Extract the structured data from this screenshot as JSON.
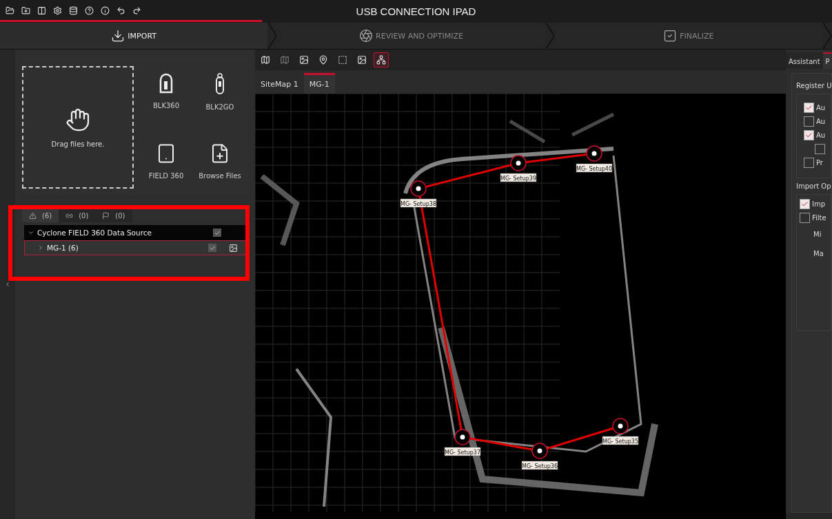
{
  "window": {
    "title": "USB CONNECTION IPAD"
  },
  "steps": [
    {
      "label": "IMPORT",
      "selected": true
    },
    {
      "label": "REVIEW AND OPTIMIZE",
      "selected": false
    },
    {
      "label": "FINALIZE",
      "selected": false
    }
  ],
  "import_panel": {
    "drop_zone": "Drag files here.",
    "sources": [
      {
        "label": "BLK360",
        "kind": "blk360"
      },
      {
        "label": "BLK2GO",
        "kind": "blk2go"
      },
      {
        "label": "FIELD 360",
        "kind": "tablet"
      },
      {
        "label": "Browse Files",
        "kind": "browse"
      }
    ]
  },
  "source_tabs": [
    {
      "count": "(6)",
      "kind": "setups",
      "selected": true
    },
    {
      "count": "(0)",
      "kind": "links",
      "selected": false
    },
    {
      "count": "(0)",
      "kind": "flags",
      "selected": false
    }
  ],
  "tree": [
    {
      "label": "Cyclone FIELD 360 Data Source",
      "expanded": true,
      "checked": true,
      "selected": false,
      "children": [
        {
          "label": "MG-1 (6)",
          "expanded": false,
          "checked": true,
          "selected": true
        }
      ]
    }
  ],
  "map_toolbar": [
    {
      "kind": "add-map",
      "disabled": false,
      "selected": false
    },
    {
      "kind": "remove-map",
      "disabled": true,
      "selected": false
    },
    {
      "kind": "photo-map",
      "disabled": false,
      "selected": false
    },
    {
      "kind": "map-pin",
      "disabled": false,
      "selected": false
    },
    {
      "kind": "selection",
      "disabled": false,
      "selected": false
    },
    {
      "kind": "image",
      "disabled": false,
      "selected": false
    },
    {
      "kind": "network",
      "disabled": false,
      "selected": true
    }
  ],
  "view_tabs": [
    {
      "label": "SiteMap 1",
      "selected": false
    },
    {
      "label": "MG-1",
      "selected": true
    }
  ],
  "map": {
    "setups": [
      {
        "label": "MG- Setup40"
      },
      {
        "label": "MG- Setup39"
      },
      {
        "label": "MG- Setup38"
      },
      {
        "label": "MG- Setup37"
      },
      {
        "label": "MG- Setup36"
      },
      {
        "label": "MG- Setup35"
      }
    ]
  },
  "right_panel": {
    "tabs": [
      {
        "label": "Assistant",
        "selected": false
      },
      {
        "label": "P",
        "selected": true
      }
    ],
    "groups": [
      {
        "title": "Register U",
        "options": [
          {
            "label": "Au",
            "checked": true,
            "kind": "option"
          },
          {
            "label": "Au",
            "checked": false,
            "kind": "option"
          },
          {
            "label": "Au",
            "checked": true,
            "kind": "option"
          },
          {
            "checked": false,
            "kind": "sub-option"
          },
          {
            "label": "Pr",
            "checked": false,
            "kind": "option"
          }
        ]
      },
      {
        "title": "Import Op",
        "options": [
          {
            "label": "Imp",
            "checked": true,
            "kind": "option"
          },
          {
            "label": "Filte",
            "checked": false,
            "kind": "option"
          },
          {
            "label": "Mi",
            "kind": "field-label"
          },
          {
            "label": "Ma",
            "kind": "field-label"
          }
        ]
      }
    ]
  }
}
